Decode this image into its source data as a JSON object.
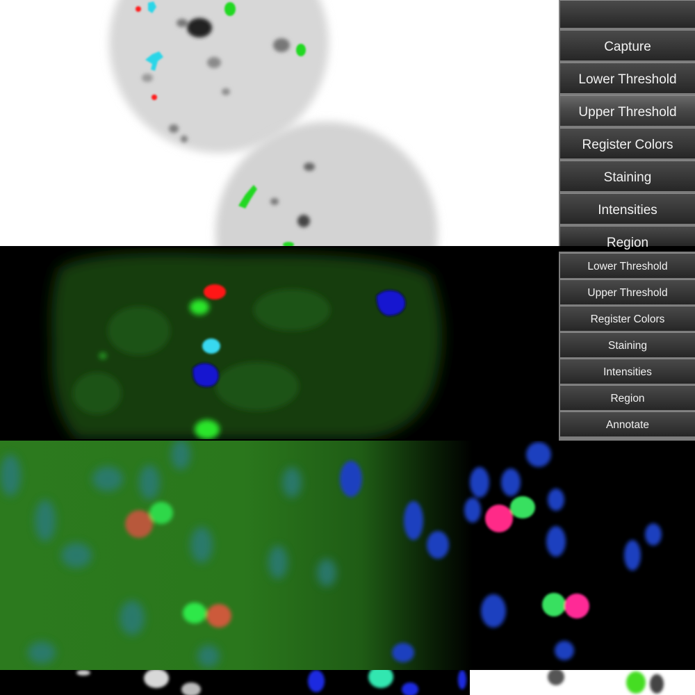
{
  "menu_top": {
    "items": [
      {
        "label": ""
      },
      {
        "label": "Capture"
      },
      {
        "label": "Lower Threshold"
      },
      {
        "label": "Upper Threshold",
        "active": true
      },
      {
        "label": "Register Colors"
      },
      {
        "label": "Staining"
      },
      {
        "label": "Intensities"
      },
      {
        "label": "Region"
      }
    ]
  },
  "menu_middle": {
    "items": [
      {
        "label": "Lower Threshold"
      },
      {
        "label": "Upper Threshold"
      },
      {
        "label": "Register Colors"
      },
      {
        "label": "Staining"
      },
      {
        "label": "Intensities"
      },
      {
        "label": "Region"
      },
      {
        "label": "Annotate"
      }
    ]
  },
  "colors": {
    "probe_red": "#ff1a1a",
    "probe_green": "#22e022",
    "probe_cyan": "#29d3e8",
    "probe_blue": "#1622d8",
    "probe_magenta": "#ff2a8a",
    "ui_button": "#333333"
  }
}
